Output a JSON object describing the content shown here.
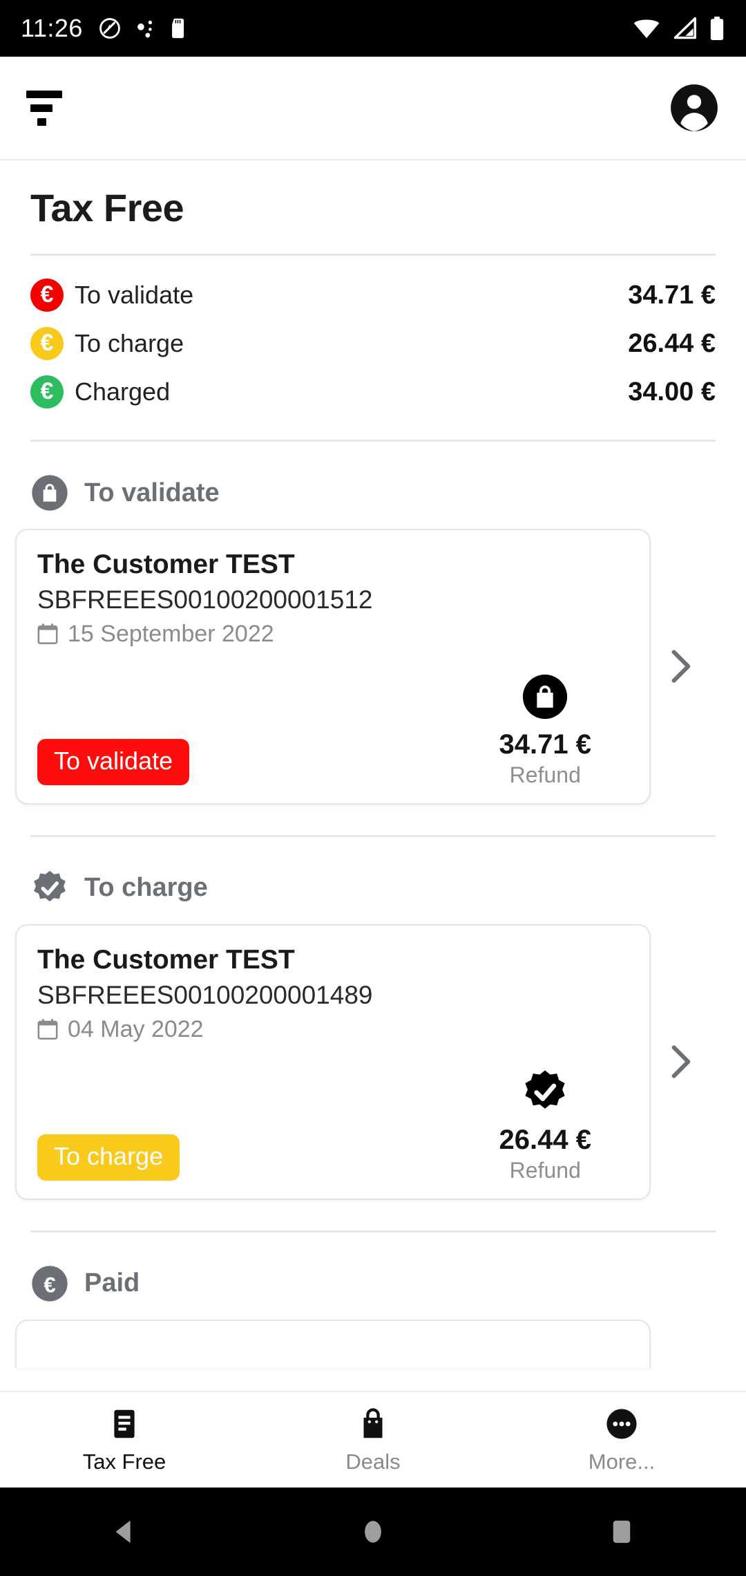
{
  "status_bar": {
    "time": "11:26",
    "icons": [
      "do-not-disturb-icon",
      "bluetooth-dots-icon",
      "sd-card-icon",
      "wifi-icon",
      "cellular-signal-icon",
      "battery-icon"
    ]
  },
  "app_bar": {
    "filter_icon": "filter-menu-icon",
    "account_icon": "account-circle-icon"
  },
  "page": {
    "title": "Tax Free"
  },
  "summary": {
    "rows": [
      {
        "label": "To validate",
        "value": "34.71 €",
        "color": "#f50000",
        "icon": "euro-coin-icon"
      },
      {
        "label": "To charge",
        "value": "26.44 €",
        "color": "#f9ca1b",
        "icon": "euro-coin-icon"
      },
      {
        "label": "Charged",
        "value": "34.00 €",
        "color": "#2dbd5f",
        "icon": "euro-coin-icon"
      }
    ]
  },
  "sections": [
    {
      "title": "To validate",
      "icon": "shopping-bag-circle-icon",
      "card": {
        "customer": "The Customer TEST",
        "code": "SBFREEES00100200001512",
        "date": "15 September 2022",
        "date_icon": "calendar-icon",
        "badge_label": "To validate",
        "badge_color": "#ff0d0d",
        "amount_icon": "shopping-bag-circle-icon",
        "amount": "34.71 €",
        "amount_caption": "Refund",
        "chevron_icon": "chevron-right-icon"
      }
    },
    {
      "title": "To charge",
      "icon": "verified-check-icon",
      "card": {
        "customer": "The Customer TEST",
        "code": "SBFREEES00100200001489",
        "date": "04 May 2022",
        "date_icon": "calendar-icon",
        "badge_label": "To charge",
        "badge_color": "#f9ca1b",
        "amount_icon": "verified-check-icon",
        "amount": "26.44 €",
        "amount_caption": "Refund",
        "chevron_icon": "chevron-right-icon"
      }
    },
    {
      "title": "Paid",
      "icon": "euro-circle-icon"
    }
  ],
  "bottom_nav": {
    "items": [
      {
        "label": "Tax Free",
        "icon": "tax-free-list-icon",
        "active": true
      },
      {
        "label": "Deals",
        "icon": "shopping-bag-icon",
        "active": false
      },
      {
        "label": "More...",
        "icon": "more-dots-icon",
        "active": false
      }
    ]
  },
  "android_nav": {
    "items": [
      {
        "label": "back",
        "icon": "back-triangle-icon"
      },
      {
        "label": "home",
        "icon": "home-circle-icon"
      },
      {
        "label": "recents",
        "icon": "recents-square-icon"
      }
    ]
  }
}
